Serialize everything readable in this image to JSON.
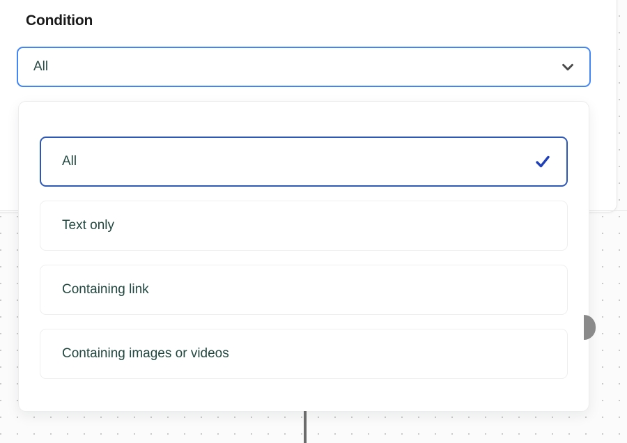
{
  "field": {
    "label": "Condition",
    "selected_value": "All",
    "chevron_icon": "chevron-down-icon",
    "border_color": "#4285f4",
    "text_color": "#2a4a44"
  },
  "dropdown": {
    "open": true,
    "check_icon": "check-icon",
    "check_color": "#1f3fb8",
    "selected_border_color": "#2d58b8",
    "options": [
      {
        "label": "All",
        "selected": true
      },
      {
        "label": "Text only",
        "selected": false
      },
      {
        "label": "Containing link",
        "selected": false
      },
      {
        "label": "Containing images or videos",
        "selected": false
      }
    ]
  },
  "canvas": {
    "dot_color": "#c9c9c9",
    "background_color": "#fbfbfb"
  },
  "handles": {
    "drag_handle_color": "#8a8a8a",
    "divider_color": "#6b6b6b"
  }
}
